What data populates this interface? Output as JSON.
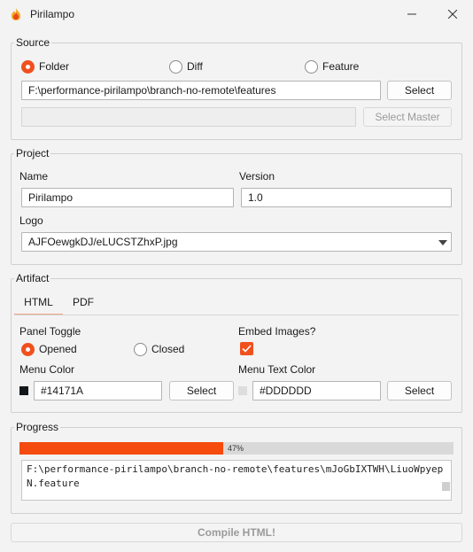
{
  "window": {
    "title": "Pirilampo"
  },
  "source": {
    "group_title": "Source",
    "radios": [
      {
        "label": "Folder",
        "selected": true
      },
      {
        "label": "Diff",
        "selected": false
      },
      {
        "label": "Feature",
        "selected": false
      }
    ],
    "path_value": "F:\\performance-pirilampo\\branch-no-remote\\features",
    "select_label": "Select",
    "master_value": "",
    "select_master_label": "Select Master"
  },
  "project": {
    "group_title": "Project",
    "name_label": "Name",
    "name_value": "Pirilampo",
    "version_label": "Version",
    "version_value": "1.0",
    "logo_label": "Logo",
    "logo_value": "AJFOewgkDJ/eLUCSTZhxP.jpg"
  },
  "artifact": {
    "group_title": "Artifact",
    "tabs": [
      {
        "label": "HTML",
        "active": true
      },
      {
        "label": "PDF",
        "active": false
      }
    ],
    "panel_toggle_label": "Panel Toggle",
    "panel_radios": [
      {
        "label": "Opened",
        "selected": true
      },
      {
        "label": "Closed",
        "selected": false
      }
    ],
    "embed_images_label": "Embed Images?",
    "embed_images_checked": true,
    "menu_color_label": "Menu Color",
    "menu_color_value": "#14171A",
    "menu_color_select_label": "Select",
    "menu_text_color_label": "Menu Text Color",
    "menu_text_color_value": "#DDDDDD",
    "menu_text_color_select_label": "Select"
  },
  "progress": {
    "group_title": "Progress",
    "percent_text": "47%",
    "percent_fraction": 0.47,
    "log_text": "F:\\performance-pirilampo\\branch-no-remote\\features\\mJoGbIXTWH\\LiuoWpyepN.feature"
  },
  "compile_label": "Compile HTML!",
  "colors": {
    "accent": "#f0501e",
    "progress_fill": "#f54b0e",
    "menu_color": "#14171A",
    "menu_text_color": "#DDDDDD"
  }
}
